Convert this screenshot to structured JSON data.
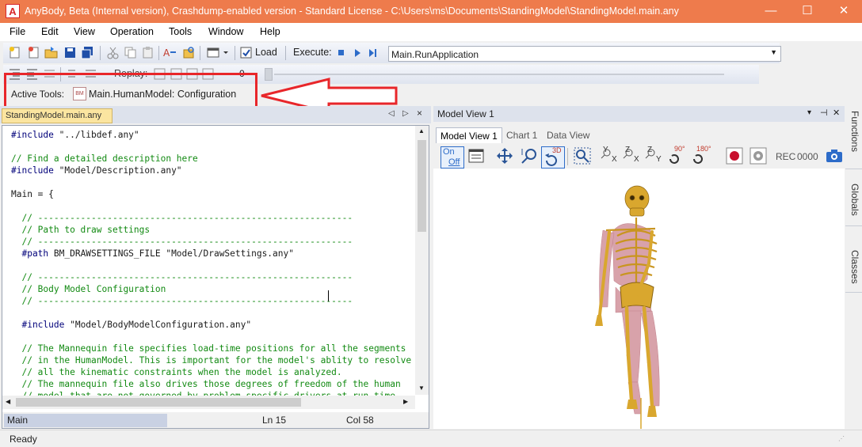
{
  "window": {
    "title": "AnyBody, Beta (Internal version), Crashdump-enabled version  -  Standard License  -  C:\\Users\\ms\\Documents\\StandingModel\\StandingModel.main.any",
    "app_icon_letter": "A",
    "minimize_glyph": "—",
    "maximize_glyph": "☐",
    "close_glyph": "✕"
  },
  "menu": [
    "File",
    "Edit",
    "View",
    "Operation",
    "Tools",
    "Window",
    "Help"
  ],
  "toolbar": {
    "load_label": "Load",
    "execute_label": "Execute:",
    "command_value": "Main.RunApplication",
    "replay_label": "Replay:",
    "replay_value": "0",
    "active_tools_label": "Active Tools:",
    "active_tool_value": "Main.HumanModel: Configuration",
    "active_tool_icon_text": "BM"
  },
  "editor": {
    "tab_label": "StandingModel.main.any",
    "tab_nav": [
      "◁",
      "▷",
      "×"
    ],
    "lines": [
      [
        {
          "t": "#include ",
          "c": "dir"
        },
        {
          "t": "\"../libdef.any\"",
          "c": "str"
        }
      ],
      [],
      [
        {
          "t": "// Find a detailed description here",
          "c": "com"
        }
      ],
      [
        {
          "t": "#include ",
          "c": "dir"
        },
        {
          "t": "\"Model/Description.any\"",
          "c": "str"
        }
      ],
      [],
      [
        {
          "t": "Main = {",
          "c": "str"
        }
      ],
      [],
      [
        {
          "t": "  // -----------------------------------------------------------",
          "c": "com"
        }
      ],
      [
        {
          "t": "  // Path to draw settings",
          "c": "com"
        }
      ],
      [
        {
          "t": "  // -----------------------------------------------------------",
          "c": "com"
        }
      ],
      [
        {
          "t": "  #path ",
          "c": "dir"
        },
        {
          "t": "BM_DRAWSETTINGS_FILE \"Model/DrawSettings.any\"",
          "c": "str"
        }
      ],
      [],
      [
        {
          "t": "  // -----------------------------------------------------------",
          "c": "com"
        }
      ],
      [
        {
          "t": "  // Body Model Configuration",
          "c": "com"
        }
      ],
      [
        {
          "t": "  // -----------------------------------------------------------",
          "c": "com"
        }
      ],
      [],
      [
        {
          "t": "  #include ",
          "c": "dir"
        },
        {
          "t": "\"Model/BodyModelConfiguration.any\"",
          "c": "str"
        }
      ],
      [],
      [
        {
          "t": "  // The Mannequin file specifies load-time positions for all the segments",
          "c": "com"
        }
      ],
      [
        {
          "t": "  // in the HumanModel. This is important for the model's ablity to resolve",
          "c": "com"
        }
      ],
      [
        {
          "t": "  // all the kinematic constraints when the model is analyzed.",
          "c": "com"
        }
      ],
      [
        {
          "t": "  // The mannequin file also drives those degrees of freedom of the human",
          "c": "com"
        }
      ],
      [
        {
          "t": "  // model that are not governed by problem-specific drivers at run time.",
          "c": "com"
        }
      ]
    ],
    "status_main": "Main",
    "status_ln": "Ln 15",
    "status_col": "Col 58"
  },
  "model_view": {
    "title": "Model View 1",
    "header_controls": [
      "▾",
      "⊣",
      "✕"
    ],
    "tabs": [
      "Model View 1",
      "Chart 1",
      "Data View"
    ],
    "onoff_top": "On",
    "onoff_bottom": "Off",
    "label_3d": "3D",
    "axis_labels": [
      "Y",
      "X",
      "Z",
      "X",
      "Z",
      "Y"
    ],
    "rot_90": "90°",
    "rot_180": "180°",
    "rec_label": "REC",
    "rec_counter": "0000"
  },
  "side_tabs": [
    "Functions",
    "Globals",
    "Classes"
  ],
  "status": {
    "text": "Ready"
  },
  "colors": {
    "titlebar": "#ee7b4c",
    "annotation": "#e8262a",
    "bone": "#d9a72e",
    "muscle": "#d69aa2"
  }
}
